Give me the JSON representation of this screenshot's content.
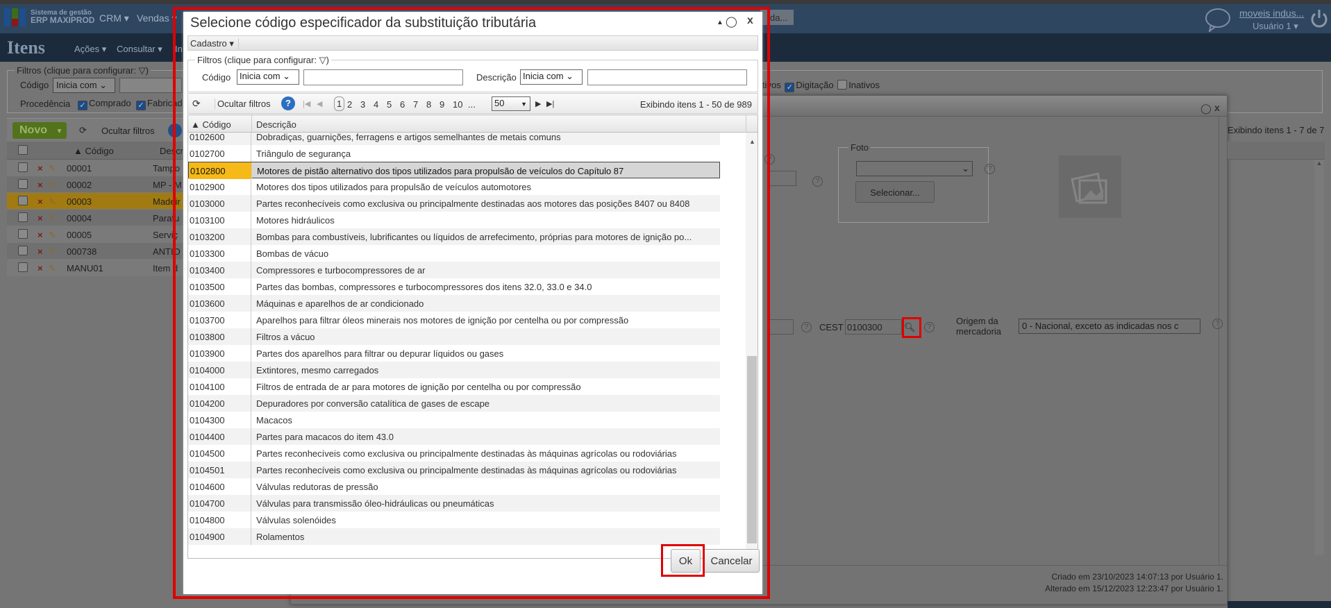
{
  "header": {
    "logo_line1": "Sistema de gestão",
    "logo_line2": "ERP MAXIPROD",
    "nav": [
      "CRM ▾",
      "Vendas ▾"
    ],
    "partial_button": "da...",
    "company_link": "moveis indus...",
    "user_menu": "Usuário 1 ▾",
    "icons": [
      "chat-bubble-icon",
      "power-icon"
    ]
  },
  "page": {
    "title": "Itens",
    "menu": [
      "Ações ▾",
      "Consultar ▾",
      "In"
    ]
  },
  "filters": {
    "legend": "Filtros (clique para configurar:",
    "codigo_label": "Código",
    "codigo_op": "Inicia com",
    "procedencia_label": "Procedência",
    "procedencia_options": [
      {
        "label": "Comprado",
        "checked": true
      },
      {
        "label": "Fabricad",
        "checked": true
      }
    ],
    "status_options": [
      {
        "label": "tivos",
        "checked": null
      },
      {
        "label": "Digitação",
        "checked": true
      },
      {
        "label": "Inativos",
        "checked": false
      }
    ]
  },
  "toolbar": {
    "new_label": "Novo",
    "hide_filters": "Ocultar filtros"
  },
  "items_table": {
    "columns": [
      "▲ Código",
      "Descriç"
    ],
    "rows": [
      {
        "code": "00001",
        "desc": "Tampo"
      },
      {
        "code": "00002",
        "desc": "MP - M"
      },
      {
        "code": "00003",
        "desc": "Madeir",
        "selected": true
      },
      {
        "code": "00004",
        "desc": "Parafu"
      },
      {
        "code": "00005",
        "desc": "Serviç"
      },
      {
        "code": "000738",
        "desc": "ANTIO"
      },
      {
        "code": "MANU01",
        "desc": "Item d"
      }
    ],
    "paging": "Exibindo itens 1 - 7 de 7"
  },
  "item_form": {
    "foto_legend": "Foto",
    "foto_select": "",
    "select_button": "Selecionar...",
    "cest_label": "CEST",
    "cest_value": "0100300",
    "origem_label_1": "Origem da",
    "origem_label_2": "mercadoria",
    "origem_value": "0 - Nacional, exceto as indicadas nos c",
    "created": "Criado em 23/10/2023 14:07:13 por Usuário 1.",
    "modified": "Alterado em 15/12/2023 12:23:47 por Usuário 1."
  },
  "dialog": {
    "title": "Selecione código especificador da substituição tributária",
    "menu_cadastro": "Cadastro ▾",
    "filters": {
      "legend": "Filtros (clique para configurar:",
      "codigo_label": "Código",
      "codigo_op": "Inicia com",
      "codigo_value": "",
      "descricao_label": "Descrição",
      "descricao_op": "Inicia com",
      "descricao_value": ""
    },
    "toolbar": {
      "hide_filters": "Ocultar filtros",
      "pages": [
        "1",
        "2",
        "3",
        "4",
        "5",
        "6",
        "7",
        "8",
        "9",
        "10",
        "..."
      ],
      "current_page": "1",
      "page_size": "50",
      "status": "Exibindo itens 1 - 50 de 989"
    },
    "columns": [
      "▲ Código",
      "Descrição"
    ],
    "rows": [
      {
        "code": "0102600",
        "desc": "Dobradiças, guarnições, ferragens e artigos semelhantes de metais comuns"
      },
      {
        "code": "0102700",
        "desc": "Triângulo de segurança"
      },
      {
        "code": "0102800",
        "desc": "Motores de pistão alternativo dos tipos utilizados para propulsão de veículos do Capítulo 87",
        "selected": true
      },
      {
        "code": "0102900",
        "desc": "Motores dos tipos utilizados para propulsão de veículos automotores"
      },
      {
        "code": "0103000",
        "desc": "Partes reconhecíveis como exclusiva ou principalmente destinadas aos motores das posições 8407 ou 8408"
      },
      {
        "code": "0103100",
        "desc": "Motores hidráulicos"
      },
      {
        "code": "0103200",
        "desc": "Bombas para combustíveis, lubrificantes ou líquidos de arrefecimento, próprias para motores de ignição po..."
      },
      {
        "code": "0103300",
        "desc": "Bombas de vácuo"
      },
      {
        "code": "0103400",
        "desc": "Compressores e turbocompressores de ar"
      },
      {
        "code": "0103500",
        "desc": "Partes das bombas, compressores e turbocompressores dos itens 32.0, 33.0 e 34.0"
      },
      {
        "code": "0103600",
        "desc": "Máquinas e aparelhos de ar condicionado"
      },
      {
        "code": "0103700",
        "desc": "Aparelhos para filtrar óleos minerais nos motores de ignição por centelha ou por compressão"
      },
      {
        "code": "0103800",
        "desc": "Filtros a vácuo"
      },
      {
        "code": "0103900",
        "desc": "Partes dos aparelhos para filtrar ou depurar líquidos ou gases"
      },
      {
        "code": "0104000",
        "desc": "Extintores, mesmo carregados"
      },
      {
        "code": "0104100",
        "desc": "Filtros de entrada de ar para motores de ignição por centelha ou por compressão"
      },
      {
        "code": "0104200",
        "desc": "Depuradores por conversão catalítica de gases de escape"
      },
      {
        "code": "0104300",
        "desc": "Macacos"
      },
      {
        "code": "0104400",
        "desc": "Partes para macacos do item 43.0"
      },
      {
        "code": "0104500",
        "desc": "Partes reconhecíveis como exclusiva ou principalmente destinadas às máquinas agrícolas ou rodoviárias"
      },
      {
        "code": "0104501",
        "desc": "Partes reconhecíveis como exclusiva ou principalmente destinadas às máquinas agrícolas ou rodoviárias"
      },
      {
        "code": "0104600",
        "desc": "Válvulas redutoras de pressão"
      },
      {
        "code": "0104700",
        "desc": "Válvulas para transmissão óleo-hidráulicas ou pneumáticas"
      },
      {
        "code": "0104800",
        "desc": "Válvulas solenóides"
      },
      {
        "code": "0104900",
        "desc": "Rolamentos"
      }
    ],
    "ok_label": "Ok",
    "cancel_label": "Cancelar"
  },
  "colors": {
    "highlight": "#e00000",
    "selected_code": "#f5b918",
    "header": "#2f4661"
  }
}
